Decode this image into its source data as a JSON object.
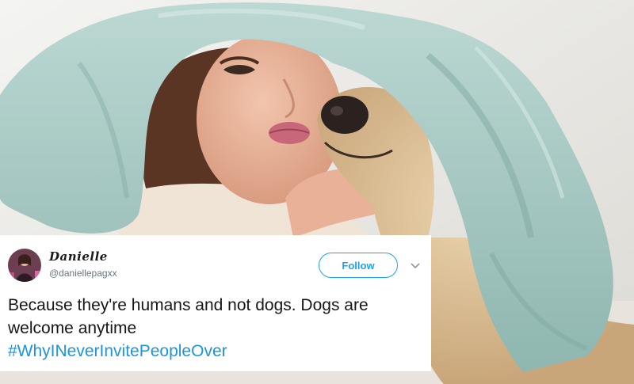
{
  "tweet": {
    "display_name": "Danielle",
    "handle": "@daniellepagxx",
    "follow_label": "Follow",
    "text": "Because they're humans and not dogs. Dogs are welcome anytime",
    "hashtag": "#WhyINeverInvitePeopleOver"
  },
  "icons": {
    "menu": "chevron-down-icon",
    "avatar": "profile-photo"
  },
  "colors": {
    "twitter_blue": "#1da1f2",
    "hashtag_blue": "#1b95e0",
    "blanket": "#a9c9c3"
  }
}
